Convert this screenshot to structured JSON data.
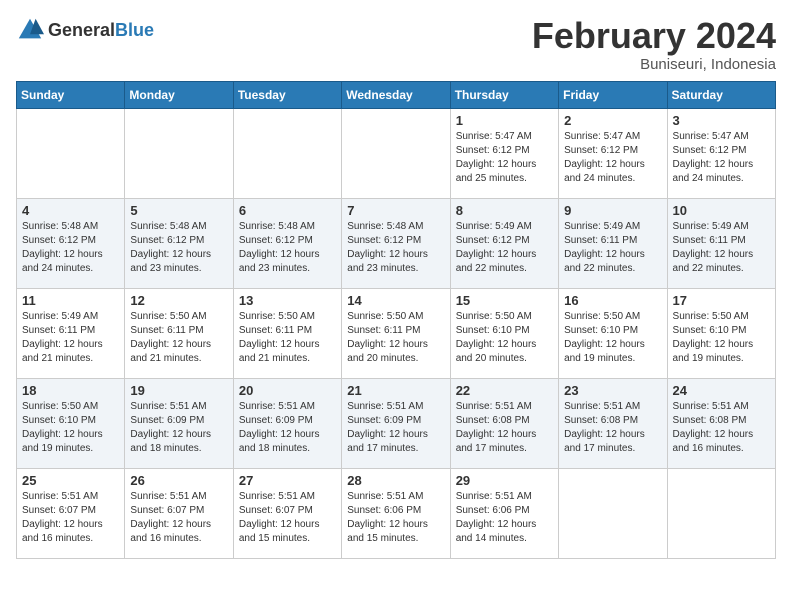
{
  "header": {
    "logo_general": "General",
    "logo_blue": "Blue",
    "title": "February 2024",
    "subtitle": "Buniseuri, Indonesia"
  },
  "days_of_week": [
    "Sunday",
    "Monday",
    "Tuesday",
    "Wednesday",
    "Thursday",
    "Friday",
    "Saturday"
  ],
  "weeks": [
    [
      {
        "day": "",
        "info": ""
      },
      {
        "day": "",
        "info": ""
      },
      {
        "day": "",
        "info": ""
      },
      {
        "day": "",
        "info": ""
      },
      {
        "day": "1",
        "info": "Sunrise: 5:47 AM\nSunset: 6:12 PM\nDaylight: 12 hours\nand 25 minutes."
      },
      {
        "day": "2",
        "info": "Sunrise: 5:47 AM\nSunset: 6:12 PM\nDaylight: 12 hours\nand 24 minutes."
      },
      {
        "day": "3",
        "info": "Sunrise: 5:47 AM\nSunset: 6:12 PM\nDaylight: 12 hours\nand 24 minutes."
      }
    ],
    [
      {
        "day": "4",
        "info": "Sunrise: 5:48 AM\nSunset: 6:12 PM\nDaylight: 12 hours\nand 24 minutes."
      },
      {
        "day": "5",
        "info": "Sunrise: 5:48 AM\nSunset: 6:12 PM\nDaylight: 12 hours\nand 23 minutes."
      },
      {
        "day": "6",
        "info": "Sunrise: 5:48 AM\nSunset: 6:12 PM\nDaylight: 12 hours\nand 23 minutes."
      },
      {
        "day": "7",
        "info": "Sunrise: 5:48 AM\nSunset: 6:12 PM\nDaylight: 12 hours\nand 23 minutes."
      },
      {
        "day": "8",
        "info": "Sunrise: 5:49 AM\nSunset: 6:12 PM\nDaylight: 12 hours\nand 22 minutes."
      },
      {
        "day": "9",
        "info": "Sunrise: 5:49 AM\nSunset: 6:11 PM\nDaylight: 12 hours\nand 22 minutes."
      },
      {
        "day": "10",
        "info": "Sunrise: 5:49 AM\nSunset: 6:11 PM\nDaylight: 12 hours\nand 22 minutes."
      }
    ],
    [
      {
        "day": "11",
        "info": "Sunrise: 5:49 AM\nSunset: 6:11 PM\nDaylight: 12 hours\nand 21 minutes."
      },
      {
        "day": "12",
        "info": "Sunrise: 5:50 AM\nSunset: 6:11 PM\nDaylight: 12 hours\nand 21 minutes."
      },
      {
        "day": "13",
        "info": "Sunrise: 5:50 AM\nSunset: 6:11 PM\nDaylight: 12 hours\nand 21 minutes."
      },
      {
        "day": "14",
        "info": "Sunrise: 5:50 AM\nSunset: 6:11 PM\nDaylight: 12 hours\nand 20 minutes."
      },
      {
        "day": "15",
        "info": "Sunrise: 5:50 AM\nSunset: 6:10 PM\nDaylight: 12 hours\nand 20 minutes."
      },
      {
        "day": "16",
        "info": "Sunrise: 5:50 AM\nSunset: 6:10 PM\nDaylight: 12 hours\nand 19 minutes."
      },
      {
        "day": "17",
        "info": "Sunrise: 5:50 AM\nSunset: 6:10 PM\nDaylight: 12 hours\nand 19 minutes."
      }
    ],
    [
      {
        "day": "18",
        "info": "Sunrise: 5:50 AM\nSunset: 6:10 PM\nDaylight: 12 hours\nand 19 minutes."
      },
      {
        "day": "19",
        "info": "Sunrise: 5:51 AM\nSunset: 6:09 PM\nDaylight: 12 hours\nand 18 minutes."
      },
      {
        "day": "20",
        "info": "Sunrise: 5:51 AM\nSunset: 6:09 PM\nDaylight: 12 hours\nand 18 minutes."
      },
      {
        "day": "21",
        "info": "Sunrise: 5:51 AM\nSunset: 6:09 PM\nDaylight: 12 hours\nand 17 minutes."
      },
      {
        "day": "22",
        "info": "Sunrise: 5:51 AM\nSunset: 6:08 PM\nDaylight: 12 hours\nand 17 minutes."
      },
      {
        "day": "23",
        "info": "Sunrise: 5:51 AM\nSunset: 6:08 PM\nDaylight: 12 hours\nand 17 minutes."
      },
      {
        "day": "24",
        "info": "Sunrise: 5:51 AM\nSunset: 6:08 PM\nDaylight: 12 hours\nand 16 minutes."
      }
    ],
    [
      {
        "day": "25",
        "info": "Sunrise: 5:51 AM\nSunset: 6:07 PM\nDaylight: 12 hours\nand 16 minutes."
      },
      {
        "day": "26",
        "info": "Sunrise: 5:51 AM\nSunset: 6:07 PM\nDaylight: 12 hours\nand 16 minutes."
      },
      {
        "day": "27",
        "info": "Sunrise: 5:51 AM\nSunset: 6:07 PM\nDaylight: 12 hours\nand 15 minutes."
      },
      {
        "day": "28",
        "info": "Sunrise: 5:51 AM\nSunset: 6:06 PM\nDaylight: 12 hours\nand 15 minutes."
      },
      {
        "day": "29",
        "info": "Sunrise: 5:51 AM\nSunset: 6:06 PM\nDaylight: 12 hours\nand 14 minutes."
      },
      {
        "day": "",
        "info": ""
      },
      {
        "day": "",
        "info": ""
      }
    ]
  ]
}
